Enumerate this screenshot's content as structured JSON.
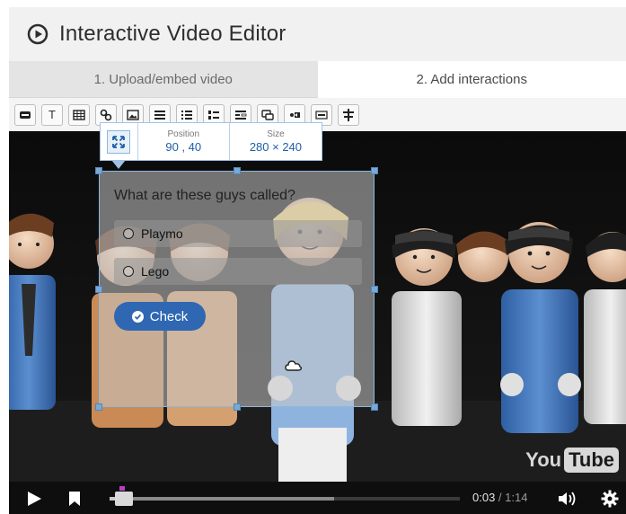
{
  "app": {
    "title": "Interactive Video Editor"
  },
  "tabs": [
    {
      "label": "1. Upload/embed video",
      "active": false
    },
    {
      "label": "2. Add interactions",
      "active": true
    }
  ],
  "toolbar": {
    "tools": [
      "label-icon",
      "text-icon",
      "table-icon",
      "link-icon",
      "image-icon",
      "statements-icon",
      "multiple-choice-icon",
      "true-false-icon",
      "fill-blanks-icon",
      "summary-icon",
      "single-choice-icon",
      "drag-words-icon",
      "navigation-icon"
    ],
    "text_tool_label": "T"
  },
  "popup": {
    "position_label": "Position",
    "position_value": "90 , 40",
    "size_label": "Size",
    "size_value": "280 × 240"
  },
  "interaction": {
    "question": "What are these guys called?",
    "answers": [
      "Playmo",
      "Lego"
    ],
    "check_label": "Check"
  },
  "player": {
    "time_current": "0:03",
    "time_separator": " / ",
    "time_duration": "1:14",
    "progress_played": 0.04,
    "progress_loaded": 0.64,
    "logo_you": "You",
    "logo_tube": "Tube"
  },
  "colors": {
    "accent": "#2f67b3",
    "selection": "#7aa9d6",
    "scrub_marker": "#b83fbf"
  }
}
